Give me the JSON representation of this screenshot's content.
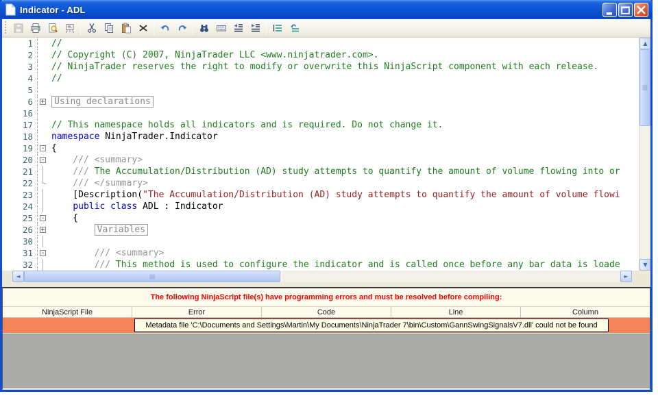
{
  "window": {
    "title": "Indicator - ADL"
  },
  "titlebar": {
    "buttons": [
      {
        "name": "minimize"
      },
      {
        "name": "maximize"
      },
      {
        "name": "close"
      }
    ]
  },
  "toolbar": {
    "icons": [
      "save",
      "print",
      "print-preview",
      "display-board",
      "cut",
      "copy",
      "paste",
      "delete",
      "undo",
      "redo",
      "find",
      "keyboard",
      "outdent",
      "indent",
      "comment-lines",
      "uncomment-lines"
    ]
  },
  "editor": {
    "syntax_colors": {
      "comment": "#1E7D1E",
      "doc_comment": "#969696",
      "keyword": "#0000E0",
      "string": "#992222",
      "plain": "#000000",
      "line_number": "#3F6868"
    },
    "lines": [
      {
        "num": "1",
        "fold": "",
        "segments": [
          {
            "t": "//",
            "c": "cmt"
          }
        ]
      },
      {
        "num": "2",
        "fold": "",
        "segments": [
          {
            "t": "// Copyright (C) 2007, NinjaTrader LLC <www.ninjatrader.com>.",
            "c": "cmt"
          }
        ]
      },
      {
        "num": "3",
        "fold": "",
        "segments": [
          {
            "t": "// NinjaTrader reserves the right to modify or overwrite this NinjaScript component with each release.",
            "c": "cmt"
          }
        ]
      },
      {
        "num": "4",
        "fold": "",
        "segments": [
          {
            "t": "//",
            "c": "cmt"
          }
        ]
      },
      {
        "num": "5",
        "fold": "",
        "segments": []
      },
      {
        "num": "6",
        "fold": "plus",
        "segments": [
          {
            "t": "Using declarations",
            "c": "box"
          }
        ]
      },
      {
        "num": "16",
        "fold": "",
        "segments": []
      },
      {
        "num": "17",
        "fold": "",
        "segments": [
          {
            "t": "// This namespace holds all indicators and is required. Do not change it.",
            "c": "cmt"
          }
        ]
      },
      {
        "num": "18",
        "fold": "",
        "segments": [
          {
            "t": "namespace",
            "c": "kw"
          },
          {
            "t": " NinjaTrader.Indicator",
            "c": "pl"
          }
        ]
      },
      {
        "num": "19",
        "fold": "minus",
        "segments": [
          {
            "t": "{",
            "c": "pl"
          }
        ]
      },
      {
        "num": "20",
        "fold": "minus",
        "segments": [
          {
            "t": "    /// <summary>",
            "c": "doc"
          }
        ]
      },
      {
        "num": "21",
        "fold": "line",
        "segments": [
          {
            "t": "    ",
            "c": "pl"
          },
          {
            "t": "///",
            "c": "doc"
          },
          {
            "t": " The Accumulation/Distribution (AD) study attempts to quantify the amount of volume flowing into or",
            "c": "cmt"
          }
        ]
      },
      {
        "num": "22",
        "fold": "end",
        "segments": [
          {
            "t": "    /// </summary>",
            "c": "doc"
          }
        ]
      },
      {
        "num": "23",
        "fold": "line",
        "segments": [
          {
            "t": "    [Description(",
            "c": "pl"
          },
          {
            "t": "\"The Accumulation/Distribution (AD) study attempts to quantify the amount of volume flowi",
            "c": "str"
          }
        ]
      },
      {
        "num": "24",
        "fold": "line",
        "segments": [
          {
            "t": "    ",
            "c": "pl"
          },
          {
            "t": "public",
            "c": "kw"
          },
          {
            "t": " ",
            "c": "pl"
          },
          {
            "t": "class",
            "c": "kw"
          },
          {
            "t": " ADL : Indicator",
            "c": "pl"
          }
        ]
      },
      {
        "num": "25",
        "fold": "minus",
        "segments": [
          {
            "t": "    {",
            "c": "pl"
          }
        ]
      },
      {
        "num": "26",
        "fold": "plus",
        "segments": [
          {
            "t": "        ",
            "c": "pl"
          },
          {
            "t": "Variables",
            "c": "box"
          }
        ]
      },
      {
        "num": "30",
        "fold": "line",
        "segments": []
      },
      {
        "num": "31",
        "fold": "minus",
        "segments": [
          {
            "t": "        /// <summary>",
            "c": "doc"
          }
        ]
      },
      {
        "num": "32",
        "fold": "line",
        "segments": [
          {
            "t": "        ",
            "c": "pl"
          },
          {
            "t": "///",
            "c": "doc"
          },
          {
            "t": " This method is used to configure the indicator and is called once before any bar data is loade",
            "c": "cmt"
          }
        ]
      }
    ]
  },
  "error_panel": {
    "message": "The following NinjaScript file(s) have programming errors and must be resolved before compiling:",
    "message_color": "#FF0000",
    "columns": [
      "NinjaScript File",
      "Error",
      "Code",
      "Line",
      "Column"
    ],
    "error_row_color": "#F5845A",
    "error_text": "Metadata file 'C:\\Documents and Settings\\Martin\\My Documents\\NinjaTrader 7\\bin\\Custom\\GannSwingSignalsV7.dll' could not be found"
  }
}
